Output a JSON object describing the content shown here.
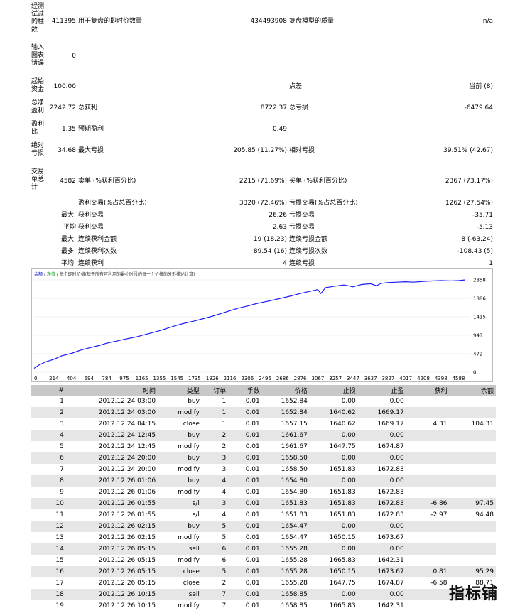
{
  "summary": {
    "bars_label": "经测试过的柱数",
    "bars_value": "411395",
    "ticks_label": "用于复盘的即时价数量",
    "ticks_value": "434493908",
    "quality_label": "复盘模型的质量",
    "quality_value": "n/a",
    "errors_label": "输入图表错误",
    "errors_value": "0",
    "deposit_label": "起始资金",
    "deposit_value": "100.00",
    "spread_label": "点差",
    "spread_value": "当前 (8)",
    "net_label": "总净盈利",
    "net_value": "2242.72",
    "gross_profit_label": "总获利",
    "gross_profit_value": "8722.37",
    "gross_loss_label": "总亏损",
    "gross_loss_value": "-6479.64",
    "pf_label": "盈利比",
    "pf_value": "1.35",
    "expected_label": "预期盈利",
    "expected_value": "0.49",
    "abs_dd_label": "绝对亏损",
    "abs_dd_value": "34.68",
    "max_dd_label": "最大亏损",
    "max_dd_value": "205.85 (11.27%)",
    "rel_dd_label": "相对亏损",
    "rel_dd_value": "39.51% (42.67)",
    "trades_label": "交易单总计",
    "trades_value": "4582",
    "short_label": "卖单 (%获利百分比)",
    "short_value": "2215 (71.69%)",
    "long_label": "买单 (%获利百分比)",
    "long_value": "2367 (73.17%)",
    "profit_trades_label": "盈利交易(%占总百分比)",
    "profit_trades_value": "3320 (72.46%)",
    "loss_trades_label": "亏损交易(%占总百分比)",
    "loss_trades_value": "1262 (27.54%)",
    "p_max": "最大:",
    "largest_profit_label": "获利交易",
    "largest_profit_value": "26.26",
    "largest_loss_label": "亏损交易",
    "largest_loss_value": "-35.71",
    "p_avg": "平均",
    "avg_profit_label": "获利交易",
    "avg_profit_value": "2.63",
    "avg_loss_label": "亏损交易",
    "avg_loss_value": "-5.13",
    "p_max2": "最大:",
    "cons_win_money_label": "连续获利金额",
    "cons_win_money_value": "19 (18.23)",
    "cons_loss_money_label": "连续亏损金额",
    "cons_loss_money_value": "8 (-63.24)",
    "p_most": "最多:",
    "cons_win_count_label": "连续获利次数",
    "cons_win_count_value": "89.54 (16)",
    "cons_loss_count_label": "连续亏损次数",
    "cons_loss_count_value": "-108.43 (5)",
    "p_avg2": "平均:",
    "avg_cons_win_label": "连续获利",
    "avg_cons_win_value": "4",
    "avg_cons_loss_label": "连续亏损",
    "avg_cons_loss_value": "1"
  },
  "chart_legend": {
    "balance": "余额",
    "sep1": " / ",
    "equity": "净值",
    "sep2": " / ",
    "desc": "每个即时价格(基于所有可利用的最小时段的每一个价格的分形描述计算)"
  },
  "chart_data": {
    "type": "line",
    "x_ticks": [
      "0",
      "214",
      "404",
      "594",
      "784",
      "975",
      "1165",
      "1355",
      "1545",
      "1735",
      "1926",
      "2116",
      "2306",
      "2496",
      "2686",
      "2876",
      "3067",
      "3257",
      "3447",
      "3637",
      "3827",
      "4017",
      "4208",
      "4398",
      "4588"
    ],
    "y_ticks": [
      "0",
      "472",
      "943",
      "1415",
      "1886",
      "2358"
    ],
    "xlim": [
      0,
      4684
    ],
    "ylim": [
      0,
      2358
    ],
    "series": [
      {
        "x": [
          0,
          50,
          120,
          214,
          300,
          404,
          500,
          594,
          700,
          784,
          900,
          975,
          1100,
          1165,
          1260,
          1355,
          1450,
          1545,
          1640,
          1735,
          1830,
          1926,
          2020,
          2116,
          2200,
          2306,
          2400,
          2496,
          2600,
          2686,
          2780,
          2876,
          2970,
          3067,
          3100,
          3150,
          3257,
          3350,
          3447,
          3540,
          3637,
          3700,
          3750,
          3827,
          3920,
          4017,
          4100,
          4208,
          4300,
          4398,
          4500,
          4588,
          4660
        ],
        "y": [
          100,
          180,
          260,
          330,
          420,
          480,
          560,
          620,
          680,
          740,
          800,
          840,
          900,
          940,
          1000,
          1060,
          1130,
          1200,
          1260,
          1310,
          1370,
          1430,
          1500,
          1570,
          1630,
          1690,
          1750,
          1800,
          1850,
          1900,
          1950,
          2010,
          2060,
          2110,
          2010,
          2160,
          2200,
          2230,
          2180,
          2240,
          2260,
          2210,
          2270,
          2290,
          2300,
          2310,
          2300,
          2320,
          2330,
          2340,
          2330,
          2340,
          2358
        ]
      }
    ]
  },
  "deals": {
    "headers": [
      "#",
      "时间",
      "类型",
      "订单",
      "手数",
      "价格",
      "止损",
      "止盈",
      "获利",
      "余额"
    ],
    "rows": [
      [
        "1",
        "2012.12.24 03:00",
        "buy",
        "1",
        "0.01",
        "1652.84",
        "0.00",
        "0.00",
        "",
        ""
      ],
      [
        "2",
        "2012.12.24 03:00",
        "modify",
        "1",
        "0.01",
        "1652.84",
        "1640.62",
        "1669.17",
        "",
        ""
      ],
      [
        "3",
        "2012.12.24 04:15",
        "close",
        "1",
        "0.01",
        "1657.15",
        "1640.62",
        "1669.17",
        "4.31",
        "104.31"
      ],
      [
        "4",
        "2012.12.24 12:45",
        "buy",
        "2",
        "0.01",
        "1661.67",
        "0.00",
        "0.00",
        "",
        ""
      ],
      [
        "5",
        "2012.12.24 12:45",
        "modify",
        "2",
        "0.01",
        "1661.67",
        "1647.75",
        "1674.87",
        "",
        ""
      ],
      [
        "6",
        "2012.12.24 20:00",
        "buy",
        "3",
        "0.01",
        "1658.50",
        "0.00",
        "0.00",
        "",
        ""
      ],
      [
        "7",
        "2012.12.24 20:00",
        "modify",
        "3",
        "0.01",
        "1658.50",
        "1651.83",
        "1672.83",
        "",
        ""
      ],
      [
        "8",
        "2012.12.26 01:06",
        "buy",
        "4",
        "0.01",
        "1654.80",
        "0.00",
        "0.00",
        "",
        ""
      ],
      [
        "9",
        "2012.12.26 01:06",
        "modify",
        "4",
        "0.01",
        "1654.80",
        "1651.83",
        "1672.83",
        "",
        ""
      ],
      [
        "10",
        "2012.12.26 01:55",
        "s/l",
        "3",
        "0.01",
        "1651.83",
        "1651.83",
        "1672.83",
        "-6.86",
        "97.45"
      ],
      [
        "11",
        "2012.12.26 01:55",
        "s/l",
        "4",
        "0.01",
        "1651.83",
        "1651.83",
        "1672.83",
        "-2.97",
        "94.48"
      ],
      [
        "12",
        "2012.12.26 02:15",
        "buy",
        "5",
        "0.01",
        "1654.47",
        "0.00",
        "0.00",
        "",
        ""
      ],
      [
        "13",
        "2012.12.26 02:15",
        "modify",
        "5",
        "0.01",
        "1654.47",
        "1650.15",
        "1673.67",
        "",
        ""
      ],
      [
        "14",
        "2012.12.26 05:15",
        "sell",
        "6",
        "0.01",
        "1655.28",
        "0.00",
        "0.00",
        "",
        ""
      ],
      [
        "15",
        "2012.12.26 05:15",
        "modify",
        "6",
        "0.01",
        "1655.28",
        "1665.83",
        "1642.31",
        "",
        ""
      ],
      [
        "16",
        "2012.12.26 05:15",
        "close",
        "5",
        "0.01",
        "1655.28",
        "1650.15",
        "1673.67",
        "0.81",
        "95.29"
      ],
      [
        "17",
        "2012.12.26 05:15",
        "close",
        "2",
        "0.01",
        "1655.28",
        "1647.75",
        "1674.87",
        "-6.58",
        "88.71"
      ],
      [
        "18",
        "2012.12.26 10:15",
        "sell",
        "7",
        "0.01",
        "1658.85",
        "0.00",
        "0.00",
        "",
        ""
      ],
      [
        "19",
        "2012.12.26 10:15",
        "modify",
        "7",
        "0.01",
        "1658.85",
        "1665.83",
        "1642.31",
        "",
        ""
      ]
    ]
  },
  "watermark": "指标铺"
}
